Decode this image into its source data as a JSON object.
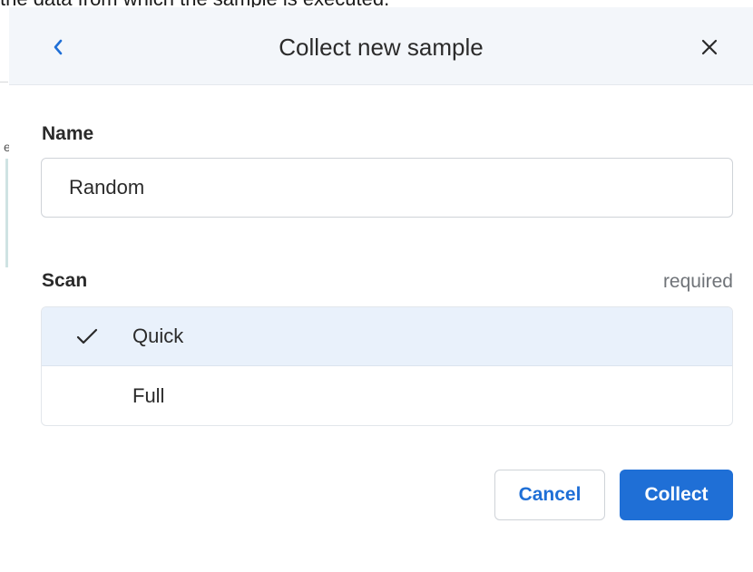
{
  "background_text": "the data from which the sample is executed.",
  "edge_fragment": "e",
  "dialog": {
    "title": "Collect new sample",
    "back_icon": "chevron-left-icon",
    "close_icon": "close-icon",
    "name": {
      "label": "Name",
      "value": "Random"
    },
    "scan": {
      "label": "Scan",
      "required_text": "required",
      "options": [
        {
          "label": "Quick",
          "selected": true
        },
        {
          "label": "Full",
          "selected": false
        }
      ]
    },
    "buttons": {
      "cancel_label": "Cancel",
      "collect_label": "Collect"
    }
  },
  "colors": {
    "accent": "#1f6fd6",
    "header_bg": "#f3f6fa",
    "selected_bg": "#e9f1fb"
  }
}
